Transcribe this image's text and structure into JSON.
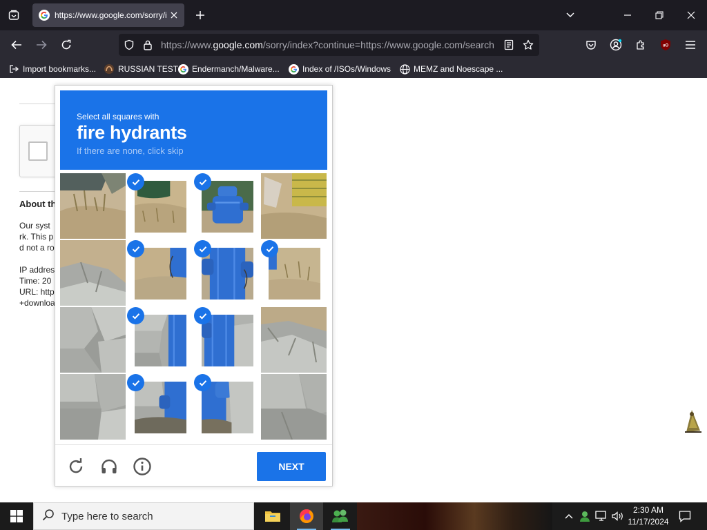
{
  "browser": {
    "tab": {
      "title": "https://www.google.com/sorry/index?continue=https://www.google.com/search",
      "favicon": "google-g-icon"
    },
    "url": {
      "prefix": "https://www.",
      "host": "google.com",
      "rest": "/sorry/index?continue=https://www.google.com/search"
    },
    "bookmarks": [
      {
        "label": "Import bookmarks...",
        "icon": "import-icon"
      },
      {
        "label": "RUSSIAN TEST",
        "icon": "site-icon"
      },
      {
        "label": "Endermanch/Malware...",
        "icon": "google-g-icon"
      },
      {
        "label": "Index of /ISOs/Windows",
        "icon": "google-g-icon"
      },
      {
        "label": "MEMZ and Noescape ...",
        "icon": "globe-icon"
      }
    ],
    "colors": {
      "tabbar": "#1c1b22",
      "toolbar": "#2b2a33",
      "accent": "#1a73e8"
    }
  },
  "background_page": {
    "heading_partial": "About th",
    "lines": [
      "Our syst",
      "rk. This p",
      "d not a ro",
      "",
      "IP addres",
      "Time: 20",
      "URL: http",
      "+downloa"
    ]
  },
  "captcha": {
    "instruction": "Select all squares with",
    "target": "fire hydrants",
    "hint": "If there are none, click skip",
    "tiles": [
      {
        "row": 1,
        "col": 1,
        "selected": false
      },
      {
        "row": 1,
        "col": 2,
        "selected": true
      },
      {
        "row": 1,
        "col": 3,
        "selected": true
      },
      {
        "row": 1,
        "col": 4,
        "selected": false
      },
      {
        "row": 2,
        "col": 1,
        "selected": false
      },
      {
        "row": 2,
        "col": 2,
        "selected": true
      },
      {
        "row": 2,
        "col": 3,
        "selected": true
      },
      {
        "row": 2,
        "col": 4,
        "selected": true
      },
      {
        "row": 3,
        "col": 1,
        "selected": false
      },
      {
        "row": 3,
        "col": 2,
        "selected": true
      },
      {
        "row": 3,
        "col": 3,
        "selected": true
      },
      {
        "row": 3,
        "col": 4,
        "selected": false
      },
      {
        "row": 4,
        "col": 1,
        "selected": false
      },
      {
        "row": 4,
        "col": 2,
        "selected": true
      },
      {
        "row": 4,
        "col": 3,
        "selected": true
      },
      {
        "row": 4,
        "col": 4,
        "selected": false
      }
    ],
    "next_label": "NEXT",
    "footer_icons": [
      "reload-icon",
      "headphones-icon",
      "info-icon"
    ]
  },
  "taskbar": {
    "search_placeholder": "Type here to search",
    "apps": [
      "file-explorer-icon",
      "firefox-icon",
      "users-app-icon"
    ],
    "time": "2:30 AM",
    "date": "11/17/2024"
  }
}
